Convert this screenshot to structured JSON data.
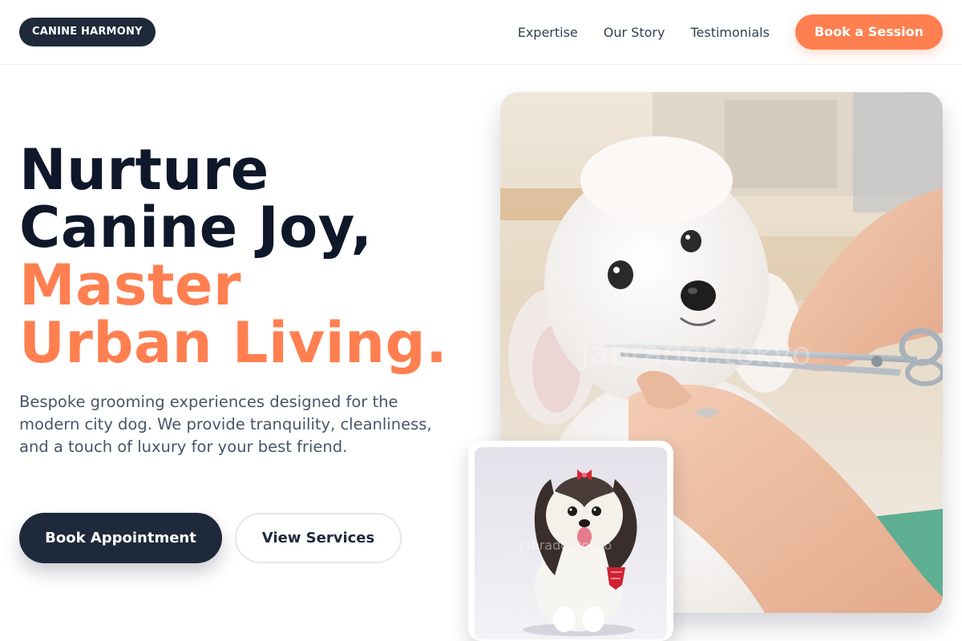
{
  "header": {
    "logo": "CANINE HARMONY",
    "nav": [
      {
        "label": "Expertise"
      },
      {
        "label": "Our Story"
      },
      {
        "label": "Testimonials"
      }
    ],
    "cta_label": "Book a Session"
  },
  "hero": {
    "headline_line1": "Nurture",
    "headline_line2": "Canine Joy,",
    "headline_accent1": "Master",
    "headline_accent2": "Urban Living.",
    "lede": "Bespoke grooming experiences designed for the modern city dog. We provide tranquility, cleanliness, and a touch of luxury for your best friend.",
    "primary_button": "Book Appointment",
    "secondary_button": "View Services"
  },
  "images": {
    "main_watermark": "Jabrador.tokyo",
    "inset_watermark": "Jabrador.tokyo"
  },
  "colors": {
    "accent": "#ff7f50",
    "dark": "#1e293b",
    "headline": "#0f172a",
    "body_text": "#475569"
  }
}
